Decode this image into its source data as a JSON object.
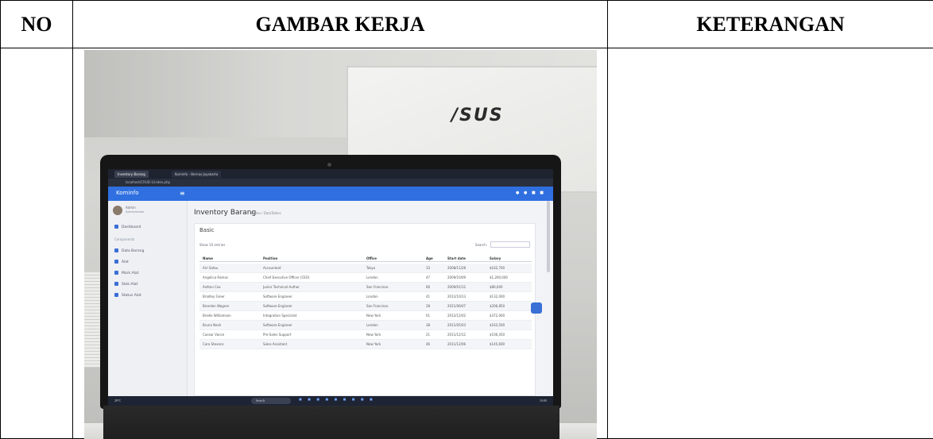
{
  "table": {
    "headers": {
      "no": "NO",
      "gambar_kerja": "GAMBAR KERJA",
      "keterangan": "KETERANGAN"
    }
  },
  "photo": {
    "background_brand": "/SUS",
    "screen": {
      "tabs": [
        "Inventory Barang",
        "Kominfo - Bernas Jayakarta"
      ],
      "address": "localhost/CRUD-1/index.php",
      "app_brand": "Kominfo",
      "hamburger_icon": "≡",
      "user": {
        "name": "Admin",
        "role": "Administrator"
      },
      "sidebar_heading": "Components",
      "sidebar_items": [
        "Dashboard",
        "Data Barang",
        "Alat",
        "Mark Alat",
        "Stok Alat",
        "Status Alat"
      ],
      "page_title": "Inventory Barang",
      "breadcrumb": "Home / DataTables",
      "card_title": "Basic",
      "show_entries": "Show 10 entries",
      "search_label": "Search:",
      "columns": [
        "Name",
        "Position",
        "Office",
        "Age",
        "Start date",
        "Salary"
      ],
      "rows": [
        [
          "Airi Satou",
          "Accountant",
          "Tokyo",
          "33",
          "2008/11/28",
          "$162,700"
        ],
        [
          "Angelica Ramos",
          "Chief Executive Officer (CEO)",
          "London",
          "47",
          "2009/10/09",
          "$1,200,000"
        ],
        [
          "Ashton Cox",
          "Junior Technical Author",
          "San Francisco",
          "66",
          "2009/01/12",
          "$86,000"
        ],
        [
          "Bradley Greer",
          "Software Engineer",
          "London",
          "41",
          "2012/10/13",
          "$132,000"
        ],
        [
          "Brenden Wagner",
          "Software Engineer",
          "San Francisco",
          "28",
          "2011/06/07",
          "$206,850"
        ],
        [
          "Brielle Williamson",
          "Integration Specialist",
          "New York",
          "61",
          "2012/12/02",
          "$372,000"
        ],
        [
          "Bruno Nash",
          "Software Engineer",
          "London",
          "38",
          "2011/05/03",
          "$163,500"
        ],
        [
          "Caesar Vance",
          "Pre-Sales Support",
          "New York",
          "21",
          "2011/12/12",
          "$106,450"
        ],
        [
          "Cara Stevens",
          "Sales Assistant",
          "New York",
          "46",
          "2011/12/06",
          "$145,600"
        ]
      ],
      "taskbar_search": "Search",
      "taskbar_weather": "28°C",
      "taskbar_time": "10:00"
    }
  }
}
